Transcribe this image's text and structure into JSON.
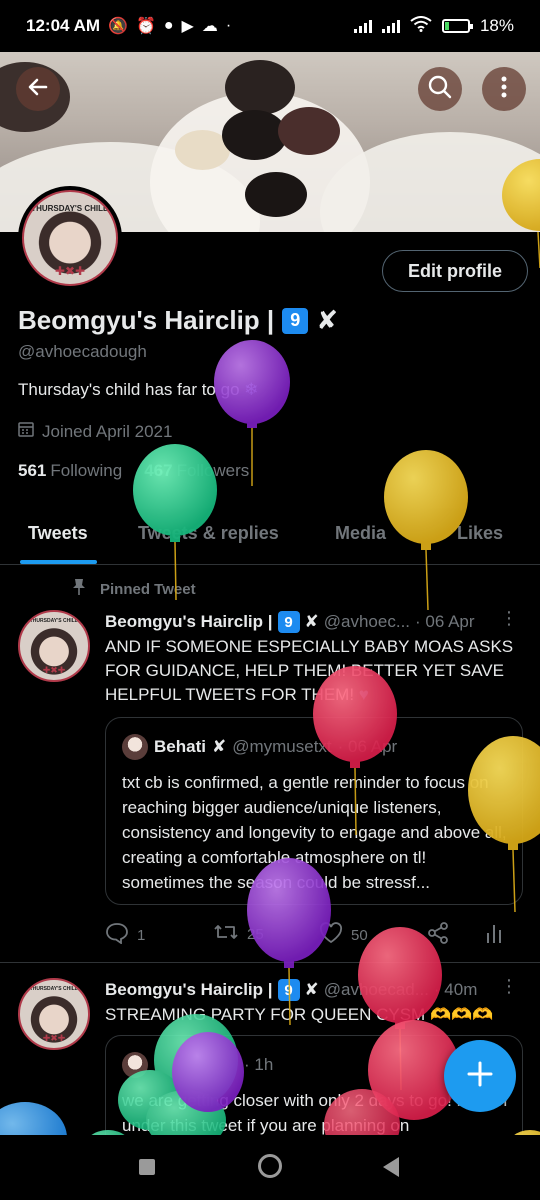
{
  "status_bar": {
    "time": "12:04 AM",
    "battery": "18%"
  },
  "profile": {
    "display_name": "Beomgyu's Hairclip |",
    "badge_number": "9",
    "handle": "@avhoecadough",
    "bio": "Thursday's child has far to go",
    "joined": "Joined April 2021",
    "following_count": "561",
    "following_label": "Following",
    "followers_count": "467",
    "followers_label": "Followers",
    "edit_label": "Edit profile",
    "avatar_caption": "THURSDAY'S CHILD"
  },
  "tabs": [
    {
      "label": "Tweets"
    },
    {
      "label": "Tweets & replies"
    },
    {
      "label": "Media"
    },
    {
      "label": "Likes"
    }
  ],
  "pinned_label": "Pinned Tweet",
  "tweets": [
    {
      "name": "Beomgyu's Hairclip |",
      "handle": "@avhoec...",
      "time": "· 06 Apr",
      "text": "AND IF SOMEONE ESPECIALLY BABY MOAS ASKS FOR GUIDANCE, HELP THEM! BETTER YET SAVE HELPFUL TWEETS FOR THEM!",
      "quote": {
        "name": "Behati",
        "handle": "@mymusetxt",
        "time": "· 06 Apr",
        "text": "txt cb is confirmed, a gentle reminder to focus on reaching bigger audience/unique listeners, consistency and longevity to engage and above all, creating a comfortable atmosphere on tl! sometimes the season could be stressf..."
      },
      "replies": "1",
      "retweets": "25",
      "likes": "50"
    },
    {
      "name": "Beomgyu's Hairclip |",
      "handle": "@avhoecad...",
      "time": "· 40m",
      "text": "STREAMING PARTY FOR QUEEN CYSM",
      "quote": {
        "time": "· 1h",
        "text": "we are getting closer with only 2 days to go! REPLY under this tweet if you are planning on"
      }
    }
  ],
  "colors": {
    "accent": "#1d9bf0",
    "background": "#000000",
    "muted": "#71767b",
    "text": "#e7e9ea"
  }
}
